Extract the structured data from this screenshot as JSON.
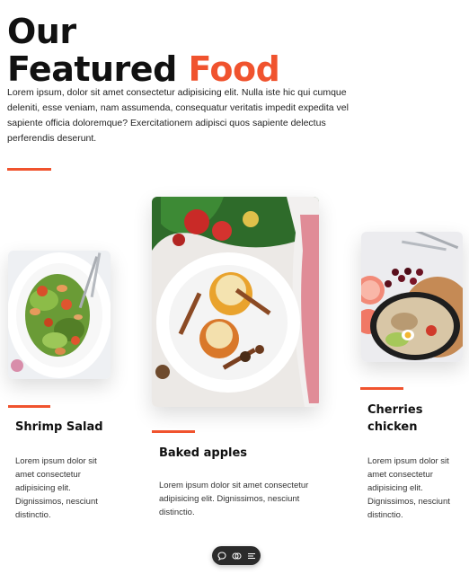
{
  "header": {
    "title_line1": "Our",
    "title_line2_prefix": "Featured",
    "title_line2_accent": "Food",
    "intro": "Lorem ipsum, dolor sit amet consectetur adipisicing elit. Nulla iste hic qui cumque deleniti, esse veniam, nam assumenda, consequatur veritatis impedit expedita vel sapiente officia doloremque? Exercitationem adipisci quos sapiente delectus perferendis deserunt."
  },
  "colors": {
    "accent": "#f0532e",
    "text": "#111111",
    "toolbar": "#2b2b2b"
  },
  "cards": [
    {
      "title": "Shrimp Salad",
      "text": "Lorem ipsum dolor sit amet consectetur adipisicing elit. Dignissimos, nesciunt distinctio."
    },
    {
      "title": "Baked apples",
      "text": "Lorem ipsum dolor sit amet consectetur adipisicing elit. Dignissimos, nesciunt distinctio."
    },
    {
      "title": "Cherries chicken",
      "text": "Lorem ipsum dolor sit amet consectetur adipisicing elit. Dignissimos, nesciunt distinctio."
    }
  ],
  "toolbar": {
    "icons": [
      "chat-icon",
      "toggle-icon",
      "menu-icon"
    ]
  }
}
